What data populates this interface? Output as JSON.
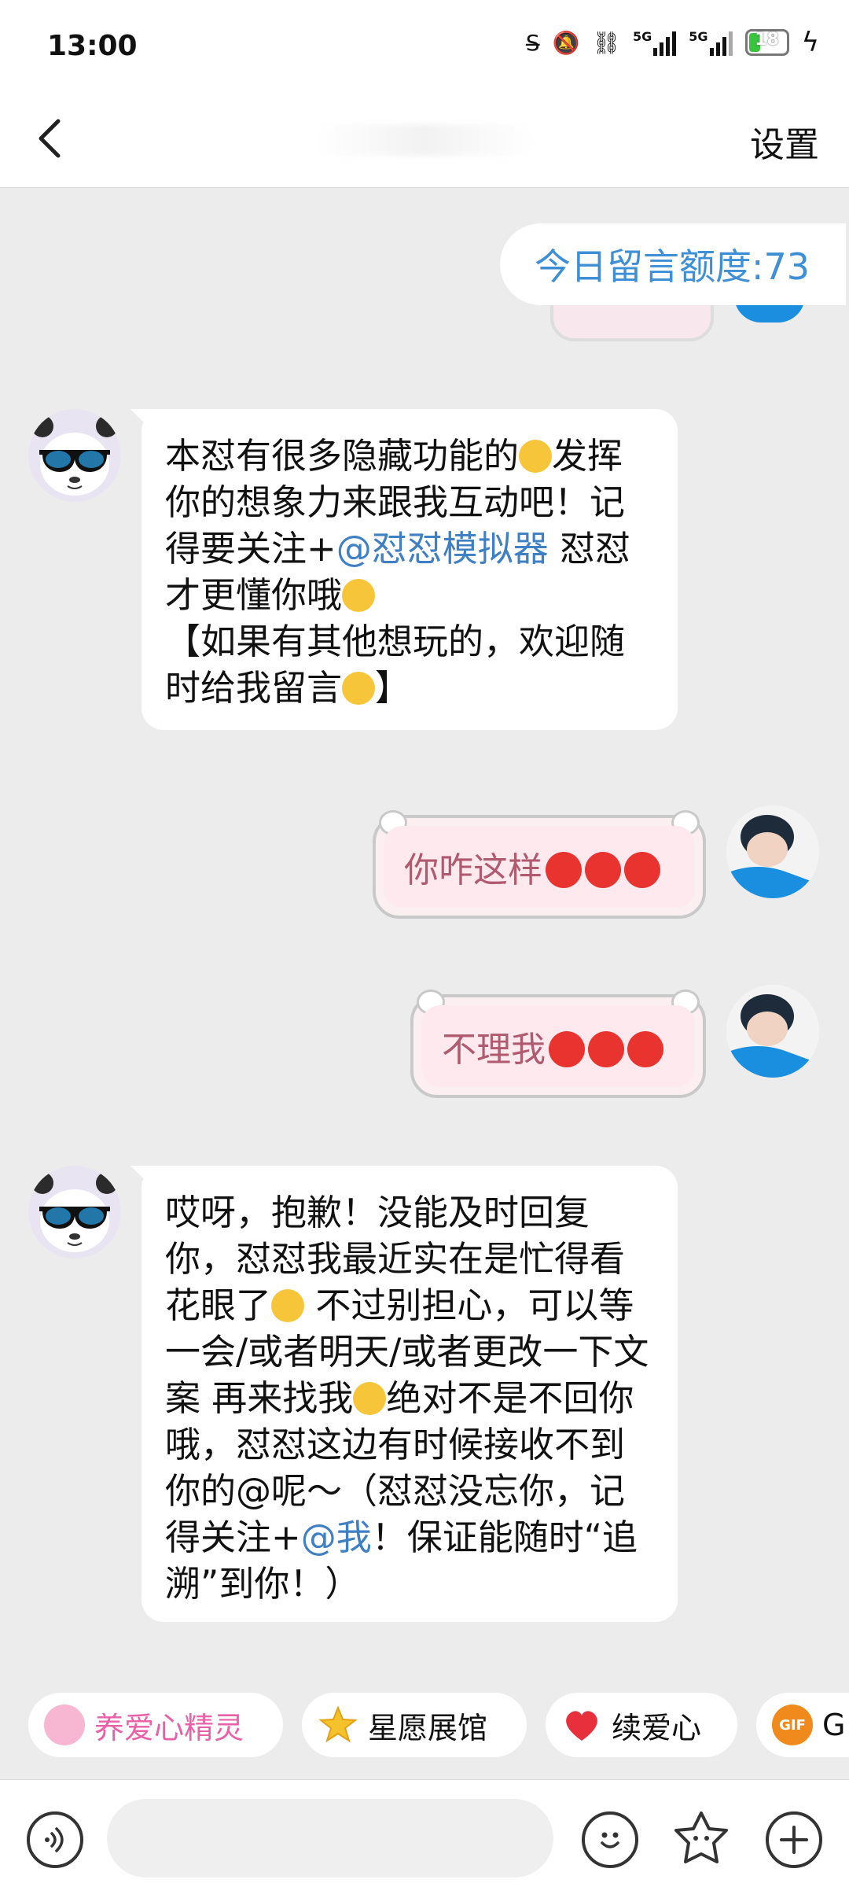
{
  "status_bar": {
    "time": "13:00",
    "network_labels": [
      "5G",
      "5G"
    ],
    "battery_level": "18"
  },
  "header": {
    "title": "",
    "settings_label": "设置"
  },
  "quota": {
    "text": "今日留言额度:73"
  },
  "messages": [
    {
      "sender": "bot",
      "parts": {
        "p1": "本怼有很多隐藏功能的",
        "p2": "发挥你的想象力来跟我互动吧！记得要关注+",
        "mention": "@怼怼模拟器",
        "p3": " 怼怼才更懂你哦",
        "p4": "【如果有其他想玩的，欢迎随时给我留言",
        "p5": "】"
      }
    },
    {
      "sender": "user",
      "text": "你咋这样"
    },
    {
      "sender": "user",
      "text": "不理我"
    },
    {
      "sender": "bot",
      "parts": {
        "p1": "哎呀，抱歉！没能及时回复你，怼怼我最近实在是忙得看花眼了",
        "p2": " 不过别担心，可以等一会/或者明天/或者更改一下文案 再来找我",
        "p3": "绝对不是不回你哦，怼怼这边有时候接收不到你的@呢～（怼怼没忘你，记得关注+",
        "mention": "@我",
        "p4": "！保证能随时“追溯”到你！）"
      }
    }
  ],
  "chips": [
    {
      "label": "养爱心精灵",
      "icon": "pink-sprite-icon",
      "color": "#e860a8"
    },
    {
      "label": "星愿展馆",
      "icon": "star-icon",
      "color": "#333333"
    },
    {
      "label": "续爱心",
      "icon": "heart-icon",
      "color": "#333333"
    },
    {
      "label": "G",
      "icon": "gif-icon",
      "color": "#333333"
    }
  ],
  "bottom_bar": {
    "input_placeholder": "",
    "icons": [
      "voice-icon",
      "smiley-icon",
      "sticker-icon",
      "plus-icon"
    ]
  },
  "colors": {
    "accent_blue": "#3f8fd6",
    "chat_bg": "#ececec",
    "user_bubble_text": "#b05a6f"
  }
}
